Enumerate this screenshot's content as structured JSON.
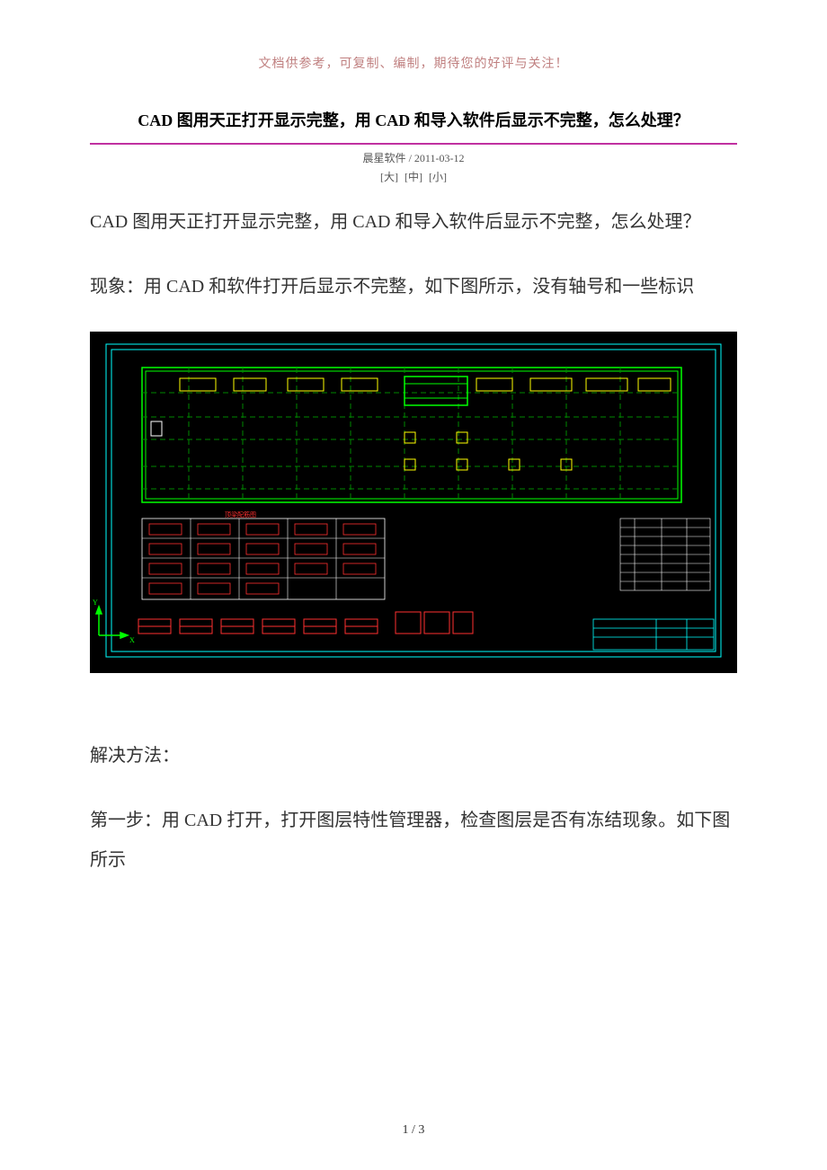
{
  "header_note": "文档供参考，可复制、编制，期待您的好评与关注！",
  "article_title": "CAD 图用天正打开显示完整，用 CAD 和导入软件后显示不完整，怎么处理？",
  "meta": {
    "source": "晨星软件",
    "sep": " / ",
    "date": "2011-03-12"
  },
  "size_links": {
    "large": "[大]",
    "medium": "[中]",
    "small": "[小]"
  },
  "para1": "CAD 图用天正打开显示完整，用 CAD 和导入软件后显示不完整，怎么处理？",
  "para2": "现象：用 CAD 和软件打开后显示不完整，如下图所示，没有轴号和一些标识",
  "para3": "解决方法：",
  "para4": "第一步：用 CAD 打开，打开图层特性管理器，检查图层是否有冻结现象。如下图所示",
  "page_num": "1 / 3",
  "cad_label": "顶梁配筋图"
}
